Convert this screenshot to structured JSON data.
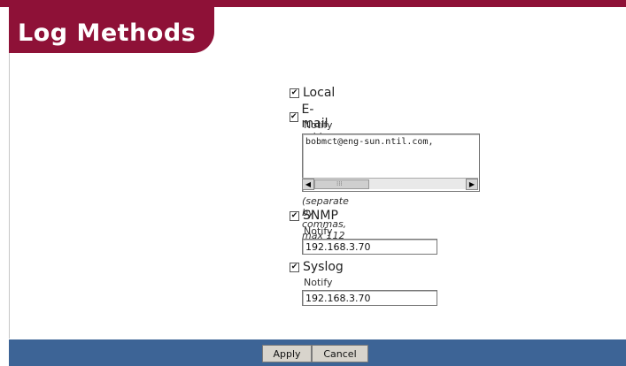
{
  "header": {
    "title": "Log Methods"
  },
  "methods": {
    "local": {
      "label": "Local",
      "checked": true
    },
    "email": {
      "label": "E-mail",
      "checked": true,
      "notify_label": "Notify addresses:",
      "value": "bobmct@eng-sun.ntil.com,",
      "hint": "(separate by commas, max 112 characters)"
    },
    "snmp": {
      "label": "SNMP",
      "checked": true,
      "notify_label": "Notify address:",
      "value": "192.168.3.70"
    },
    "syslog": {
      "label": "Syslog",
      "checked": true,
      "notify_label": "Notify address:",
      "value": "192.168.3.70"
    }
  },
  "checkbox_mark": "✔",
  "scrollbar": {
    "left_arrow": "◀",
    "right_arrow": "▶",
    "thumb_marks": "⁞⁞⁞"
  },
  "buttons": {
    "apply": "Apply",
    "cancel": "Cancel"
  },
  "colors": {
    "brand": "#8e1137",
    "footer": "#3d6496"
  }
}
